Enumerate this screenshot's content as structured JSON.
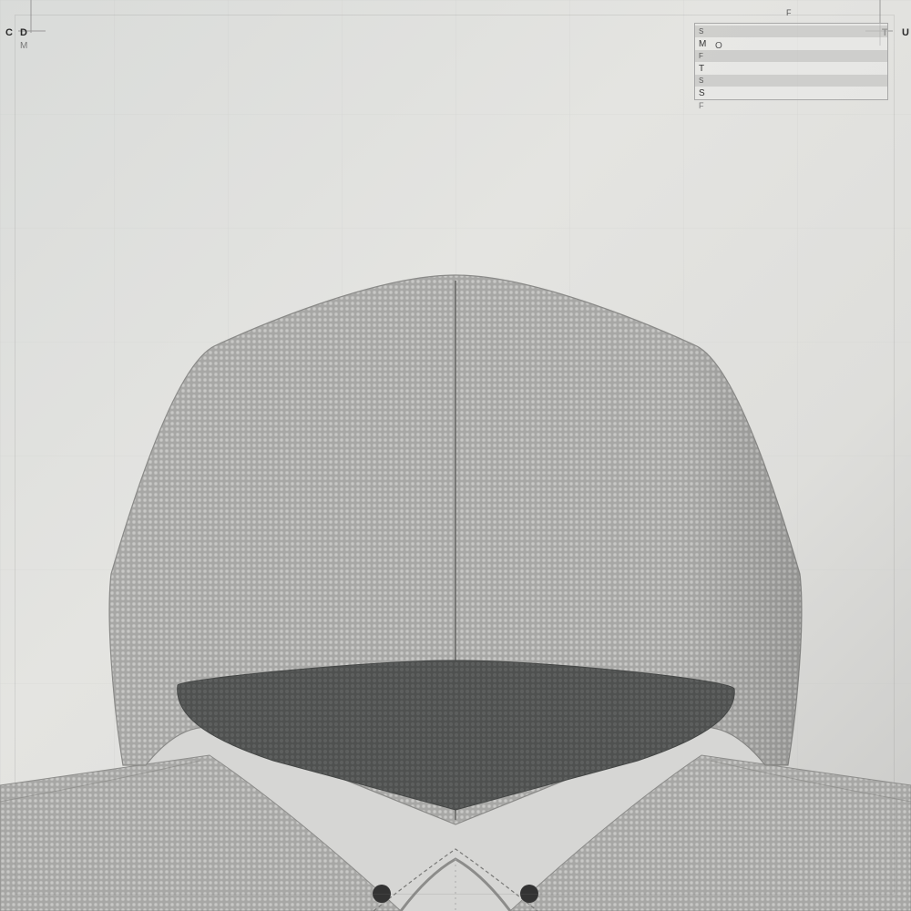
{
  "left_labels": {
    "first": "C",
    "second": "D",
    "sub": "M"
  },
  "right_labels": {
    "first": "T",
    "second": "U"
  },
  "top_label": "F",
  "size_chart": {
    "rows": [
      "S",
      "M",
      "F",
      "T",
      "S",
      "S"
    ],
    "inline_label": "O",
    "footer": "F"
  },
  "colors": {
    "background": "#dcdcda",
    "garment_fabric": "#b0b0ae",
    "hood_lining": "#5a5c5b",
    "button": "#333333"
  }
}
